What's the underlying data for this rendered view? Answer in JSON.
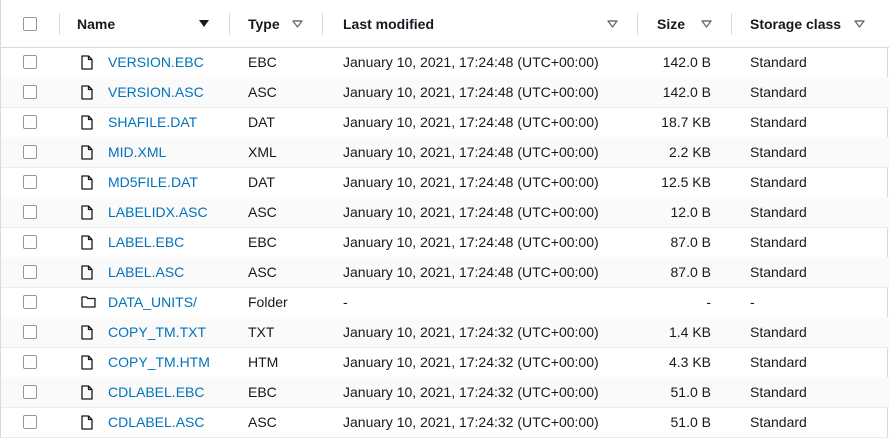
{
  "headers": {
    "name": "Name",
    "type": "Type",
    "modified": "Last modified",
    "size": "Size",
    "storage": "Storage class"
  },
  "rows": [
    {
      "name": "VERSION.EBC",
      "type": "EBC",
      "modified": "January 10, 2021, 17:24:48 (UTC+00:00)",
      "size": "142.0 B",
      "storage": "Standard",
      "icon": "file-icon"
    },
    {
      "name": "VERSION.ASC",
      "type": "ASC",
      "modified": "January 10, 2021, 17:24:48 (UTC+00:00)",
      "size": "142.0 B",
      "storage": "Standard",
      "icon": "file-icon"
    },
    {
      "name": "SHAFILE.DAT",
      "type": "DAT",
      "modified": "January 10, 2021, 17:24:48 (UTC+00:00)",
      "size": "18.7 KB",
      "storage": "Standard",
      "icon": "file-icon"
    },
    {
      "name": "MID.XML",
      "type": "XML",
      "modified": "January 10, 2021, 17:24:48 (UTC+00:00)",
      "size": "2.2 KB",
      "storage": "Standard",
      "icon": "file-icon"
    },
    {
      "name": "MD5FILE.DAT",
      "type": "DAT",
      "modified": "January 10, 2021, 17:24:48 (UTC+00:00)",
      "size": "12.5 KB",
      "storage": "Standard",
      "icon": "file-icon"
    },
    {
      "name": "LABELIDX.ASC",
      "type": "ASC",
      "modified": "January 10, 2021, 17:24:48 (UTC+00:00)",
      "size": "12.0 B",
      "storage": "Standard",
      "icon": "file-icon"
    },
    {
      "name": "LABEL.EBC",
      "type": "EBC",
      "modified": "January 10, 2021, 17:24:48 (UTC+00:00)",
      "size": "87.0 B",
      "storage": "Standard",
      "icon": "file-icon"
    },
    {
      "name": "LABEL.ASC",
      "type": "ASC",
      "modified": "January 10, 2021, 17:24:48 (UTC+00:00)",
      "size": "87.0 B",
      "storage": "Standard",
      "icon": "file-icon"
    },
    {
      "name": "DATA_UNITS/",
      "type": "Folder",
      "modified": "-",
      "size": "-",
      "storage": "-",
      "icon": "folder-icon"
    },
    {
      "name": "COPY_TM.TXT",
      "type": "TXT",
      "modified": "January 10, 2021, 17:24:32 (UTC+00:00)",
      "size": "1.4 KB",
      "storage": "Standard",
      "icon": "file-icon"
    },
    {
      "name": "COPY_TM.HTM",
      "type": "HTM",
      "modified": "January 10, 2021, 17:24:32 (UTC+00:00)",
      "size": "4.3 KB",
      "storage": "Standard",
      "icon": "file-icon"
    },
    {
      "name": "CDLABEL.EBC",
      "type": "EBC",
      "modified": "January 10, 2021, 17:24:32 (UTC+00:00)",
      "size": "51.0 B",
      "storage": "Standard",
      "icon": "file-icon"
    },
    {
      "name": "CDLABEL.ASC",
      "type": "ASC",
      "modified": "January 10, 2021, 17:24:32 (UTC+00:00)",
      "size": "51.0 B",
      "storage": "Standard",
      "icon": "file-icon"
    }
  ],
  "colors": {
    "link": "#0073bb",
    "border": "#d5dbdb",
    "row_alt": "#fafafa"
  }
}
